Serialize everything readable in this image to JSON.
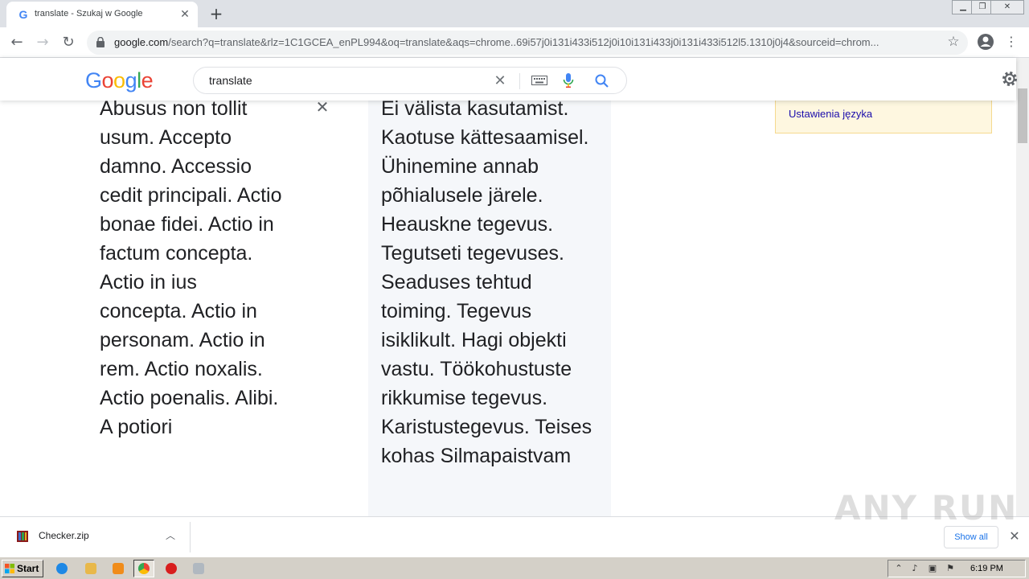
{
  "browser": {
    "tab_title": "translate - Szukaj w Google",
    "favicon_letter": "G",
    "url_host": "google.com",
    "url_path": "/search?q=translate&rlz=1C1GCEA_enPL994&oq=translate&aqs=chrome..69i57j0i131i433i512j0i10i131i433j0i131i433i512l5.1310j0j4&sourceid=chrom..."
  },
  "google": {
    "logo": "Google",
    "query": "translate",
    "logo_colors": [
      "#4285f4",
      "#ea4335",
      "#fbbc05",
      "#4285f4",
      "#34a853",
      "#ea4335"
    ]
  },
  "translation": {
    "source_text": "Abusus non tollit usum. Accepto damno. Accessio cedit principali. Actio bonae fidei. Actio in factum concepta. Actio in ius concepta. Actio in personam. Actio in rem. Actio noxalis. Actio poenalis. Alibi. A potiori",
    "target_text": "Ei välista kasutamist. Kaotuse kättesaamisel. Ühinemine annab põhialusele järele. Heauskne tegevus. Tegutseti tegevuses. Seaduses tehtud toiming. Tegevus isiklikult. Hagi objekti vastu. Töökohustuste rikkumise tegevus. Karistustegevus. Teises kohas Silmapaistvam"
  },
  "side_box": {
    "link_label": "Ustawienia języka"
  },
  "downloads": {
    "file_name": "Checker.zip",
    "show_all": "Show all",
    "watermark": "ANY RUN"
  },
  "taskbar": {
    "start_label": "Start",
    "clock": "6:19 PM"
  }
}
